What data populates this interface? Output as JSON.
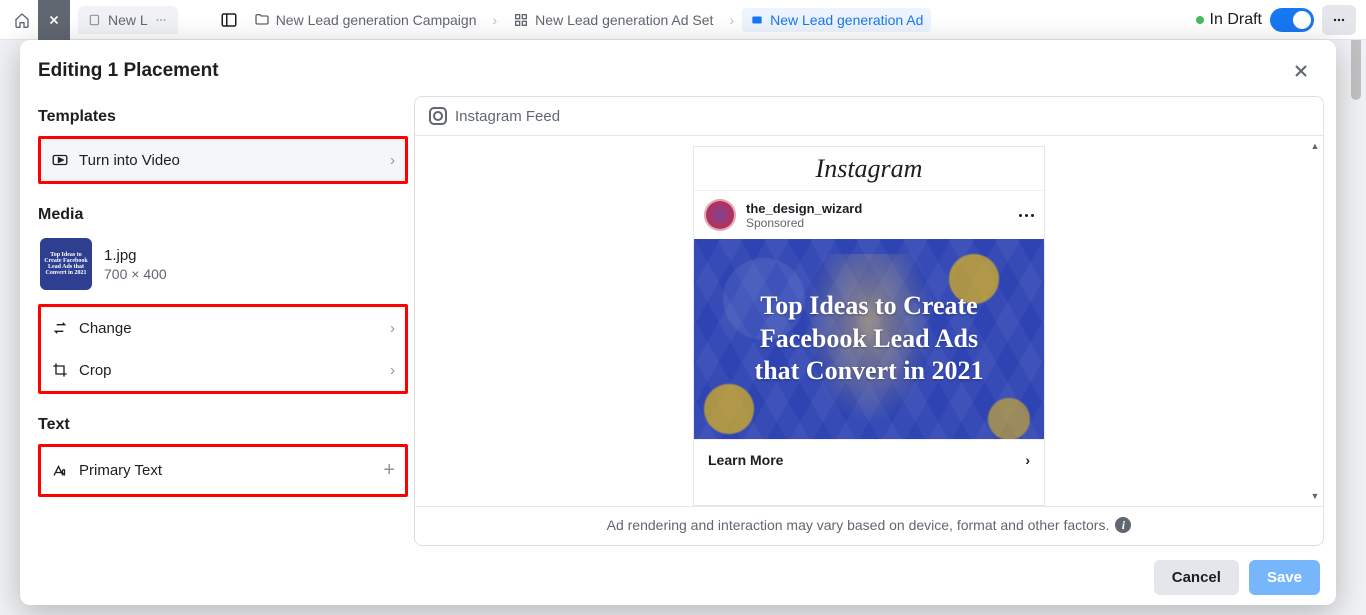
{
  "breadcrumb": {
    "campaign": "New Lead generation Campaign",
    "adset": "New Lead generation Ad Set",
    "ad": "New Lead generation Ad"
  },
  "status": {
    "label": "In Draft"
  },
  "bg_tab": {
    "label": "New L"
  },
  "modal": {
    "title": "Editing 1 Placement",
    "sections": {
      "templates": {
        "heading": "Templates",
        "turn_into_video": "Turn into Video"
      },
      "media": {
        "heading": "Media",
        "file_name": "1.jpg",
        "file_dimensions": "700 × 400",
        "thumb_text": "Top Ideas to Create Facebook Lead Ads that Convert in 2021",
        "change": "Change",
        "crop": "Crop"
      },
      "text": {
        "heading": "Text",
        "primary_text": "Primary Text"
      }
    },
    "preview": {
      "placement_label": "Instagram Feed",
      "instagram_logo": "Instagram",
      "username": "the_design_wizard",
      "sponsored": "Sponsored",
      "headline_line1": "Top Ideas to Create",
      "headline_line2": "Facebook Lead Ads",
      "headline_line3": "that Convert in 2021",
      "cta": "Learn More",
      "disclaimer": "Ad rendering and interaction may vary based on device, format and other factors."
    },
    "footer": {
      "cancel": "Cancel",
      "save": "Save"
    }
  }
}
